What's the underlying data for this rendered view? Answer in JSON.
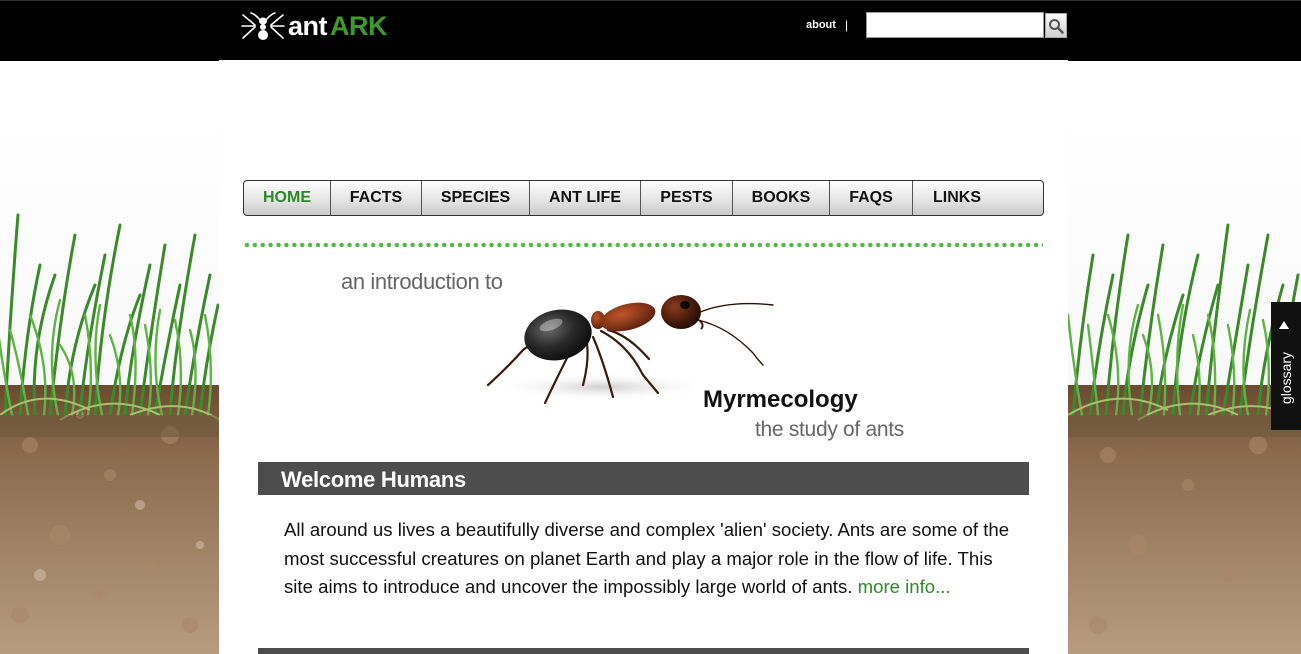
{
  "header": {
    "logo_part1": "ant",
    "logo_part2": "ARK",
    "about_label": "about",
    "separator": "|",
    "search_placeholder": "",
    "search_icon": "magnifier-icon"
  },
  "nav": {
    "items": [
      {
        "label": "HOME",
        "active": true
      },
      {
        "label": "FACTS"
      },
      {
        "label": "SPECIES"
      },
      {
        "label": "ANT LIFE"
      },
      {
        "label": "PESTS"
      },
      {
        "label": "BOOKS"
      },
      {
        "label": "FAQS"
      },
      {
        "label": "LINKS"
      }
    ]
  },
  "hero": {
    "intro": "an introduction to",
    "title": "Myrmecology",
    "subtitle": "the study of ants"
  },
  "welcome": {
    "title": "Welcome Humans",
    "body": "All around us lives a beautifully diverse and complex 'alien' society. Ants are some of the most successful creatures on planet Earth and play a major role in the flow of life. This site aims to introduce and uncover the impossibly large world of ants.",
    "more_link": "more info..."
  },
  "glossary": {
    "label": "glossary"
  },
  "colors": {
    "accent_green": "#2c8a26",
    "dots_green": "#52b848",
    "bar_gray": "#4d4d4d"
  }
}
